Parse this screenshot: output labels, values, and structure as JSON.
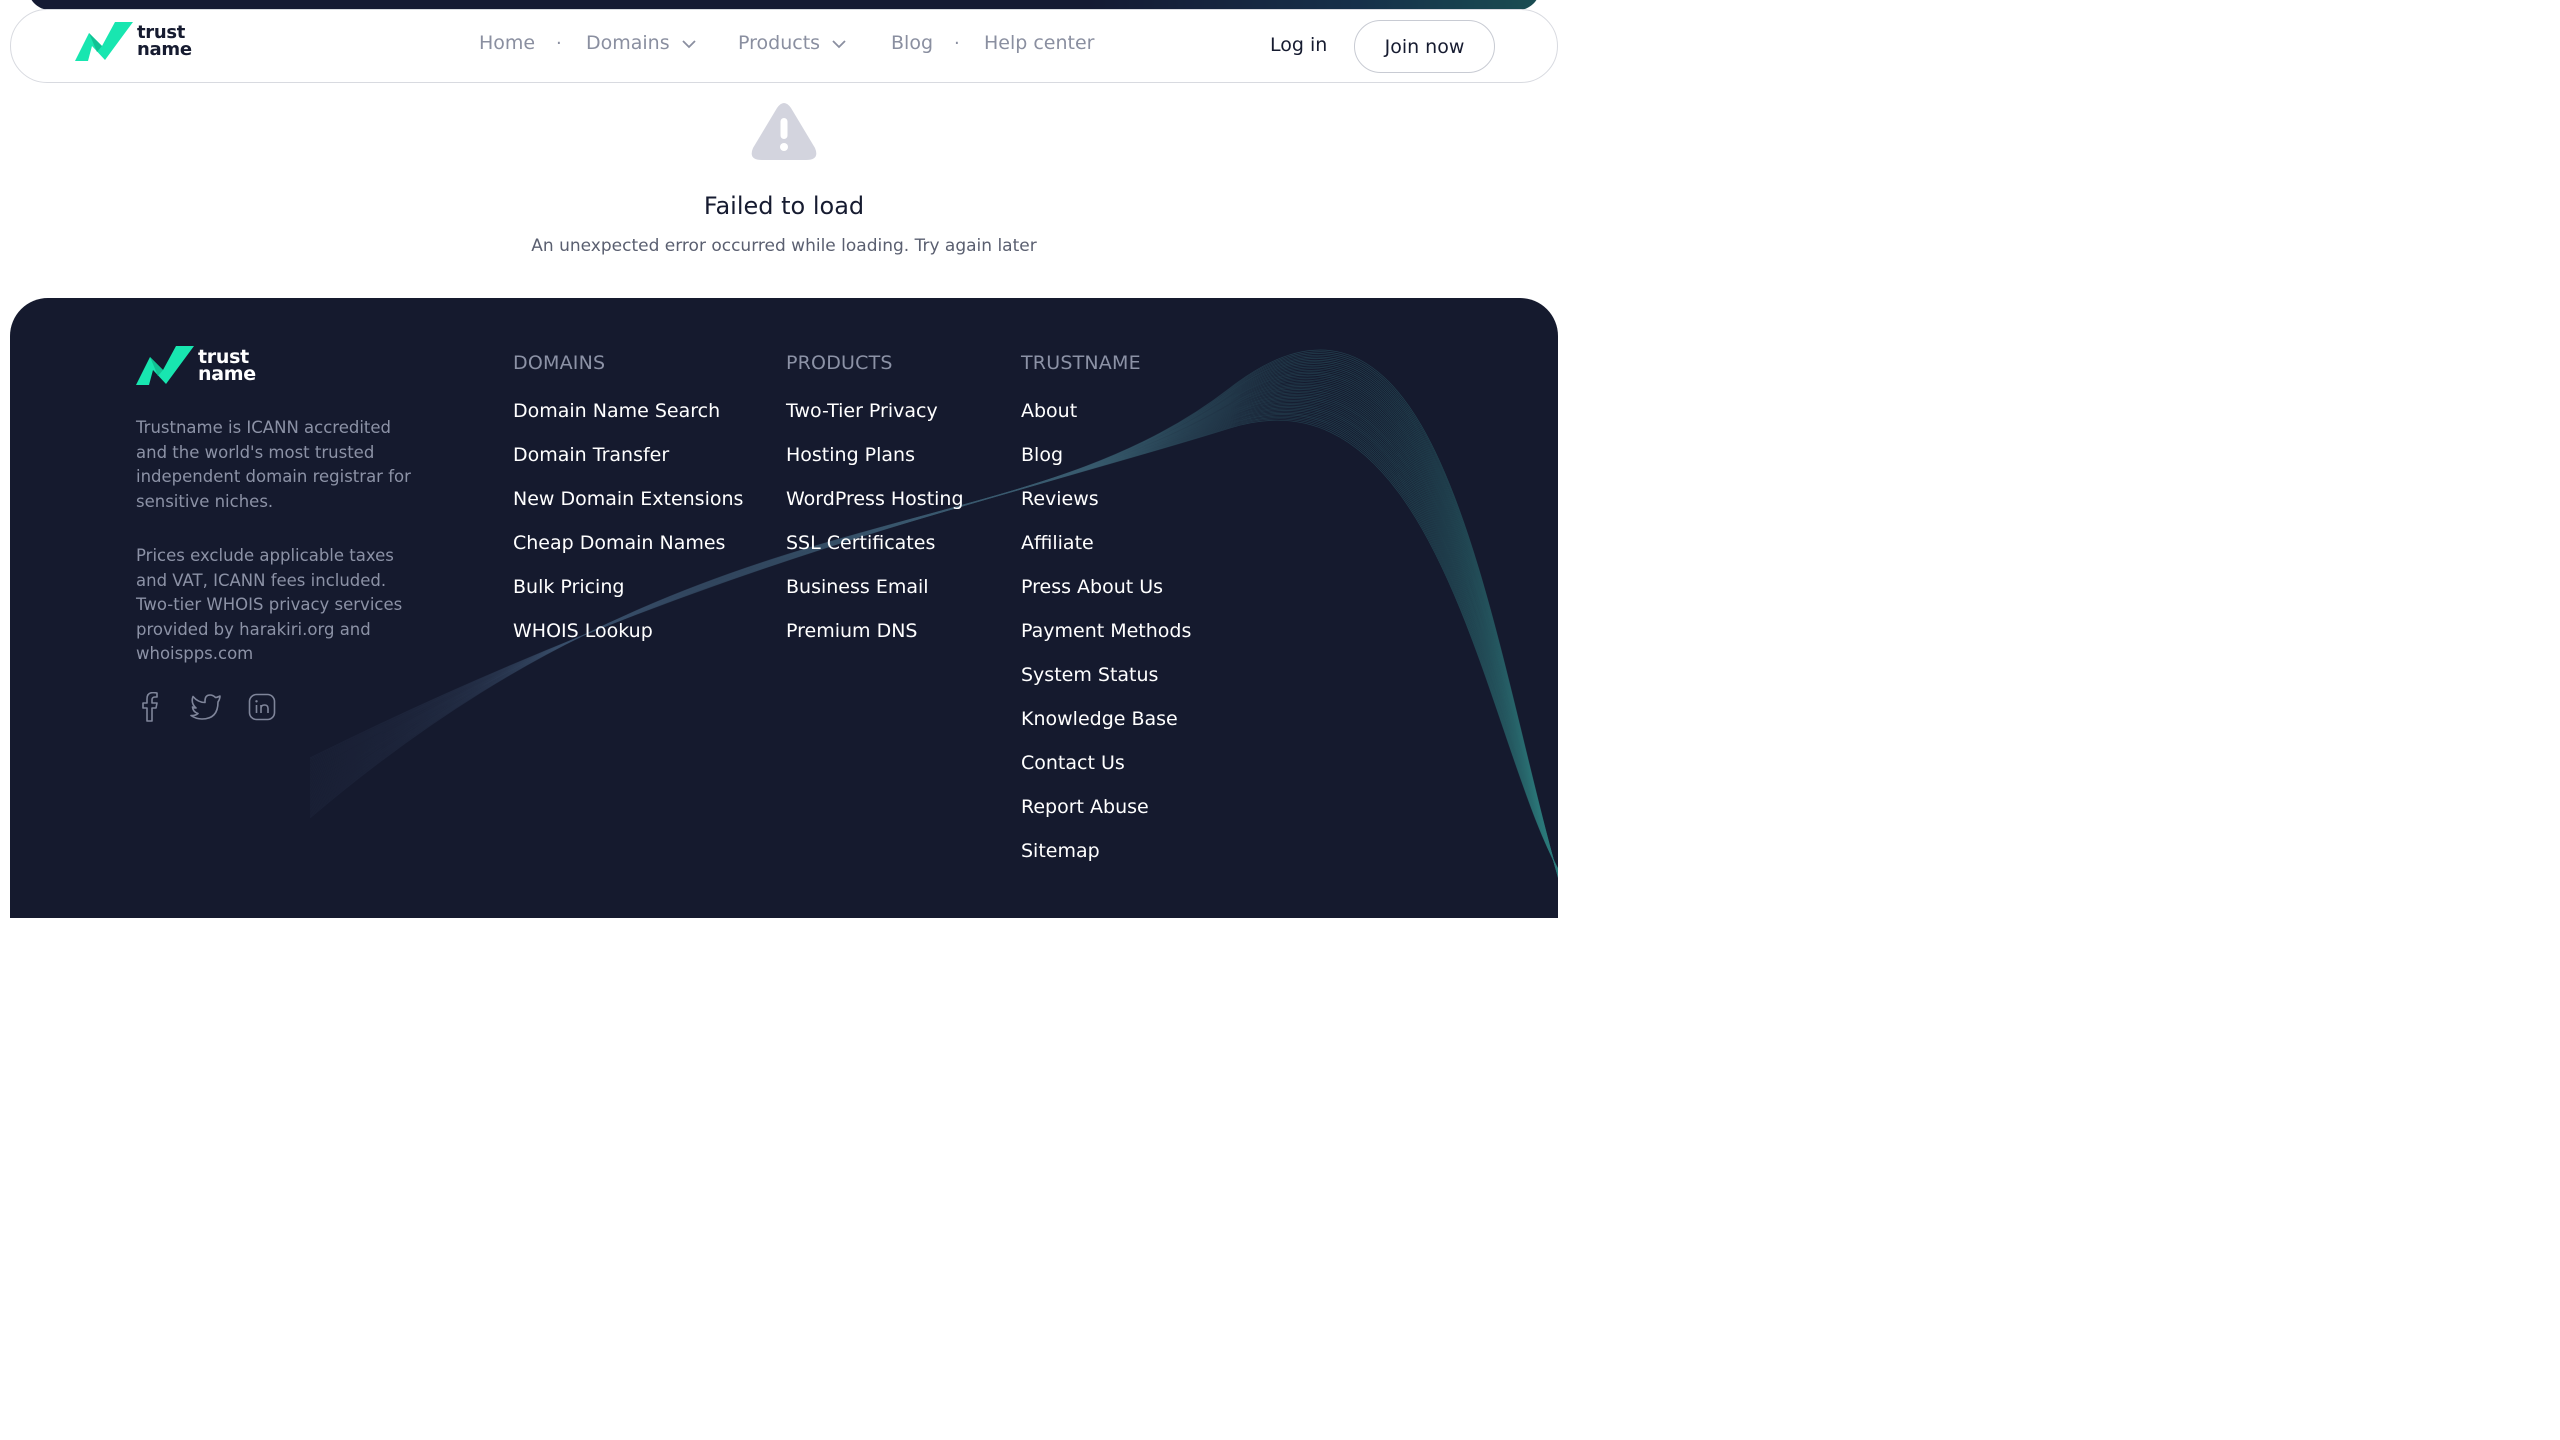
{
  "colors": {
    "accent": "#18e6b0",
    "dark": "#151a2e",
    "nav_text": "#8a8fa0",
    "warning_icon": "#d3d4de"
  },
  "header": {
    "logo_line1": "trust",
    "logo_line2": "name",
    "nav": [
      {
        "label": "Home"
      },
      {
        "label": "Domains",
        "icon": "chevron-down-icon"
      },
      {
        "label": "Products",
        "icon": "chevron-down-icon"
      },
      {
        "label": "Blog"
      },
      {
        "label": "Help center"
      }
    ],
    "separator": "·",
    "login_label": "Log in",
    "join_label": "Join now"
  },
  "error": {
    "icon": "warning-icon",
    "title": "Failed to load",
    "message": "An unexpected error occurred while loading. Try again later"
  },
  "footer": {
    "logo_line1": "trust",
    "logo_line2": "name",
    "description": "Trustname is ICANN accredited and the world's most trusted independent domain registrar for sensitive niches.",
    "disclaimer": "Prices exclude applicable taxes and VAT, ICANN fees included. Two-tier WHOIS privacy services provided by harakiri.org and whoispps.com",
    "socials": [
      "facebook-icon",
      "twitter-icon",
      "linkedin-icon"
    ],
    "columns": [
      {
        "heading": "DOMAINS",
        "links": [
          "Domain Name Search",
          "Domain Transfer",
          "New Domain Extensions",
          "Cheap Domain Names",
          "Bulk Pricing",
          "WHOIS Lookup"
        ]
      },
      {
        "heading": "PRODUCTS",
        "links": [
          "Two-Tier Privacy",
          "Hosting Plans",
          "WordPress Hosting",
          "SSL Certificates",
          "Business Email",
          "Premium DNS"
        ]
      },
      {
        "heading": "TRUSTNAME",
        "links": [
          "About",
          "Blog",
          "Reviews",
          "Affiliate",
          "Press About Us",
          "Payment Methods",
          "System Status",
          "Knowledge Base",
          "Contact Us",
          "Report Abuse",
          "Sitemap"
        ]
      }
    ]
  }
}
